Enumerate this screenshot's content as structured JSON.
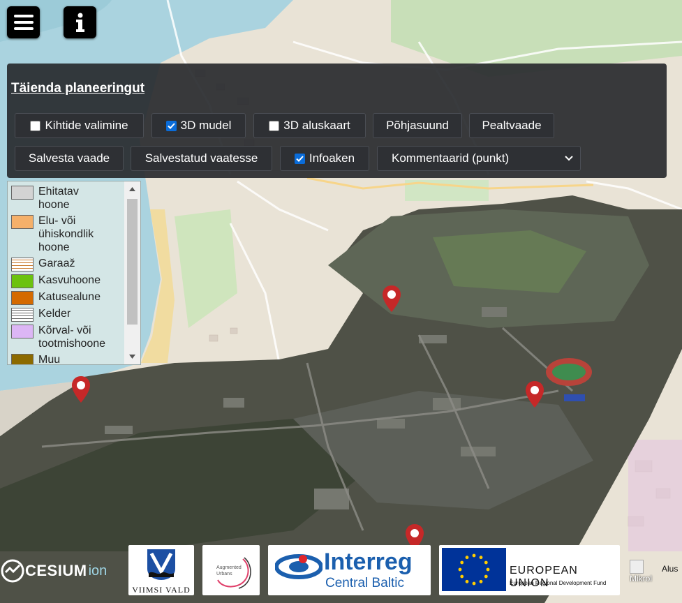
{
  "toolbar": {
    "title": "Täienda planeeringut",
    "buttons": {
      "layers": "Kihtide valimine",
      "model3d": "3D mudel",
      "basemap3d": "3D aluskaart",
      "north": "Põhjasuund",
      "topview": "Pealtvaade",
      "saveview": "Salvesta vaade",
      "savedviews": "Salvestatud vaatesse",
      "infowindow": "Infoaken"
    },
    "checkboxes": {
      "layers": false,
      "model3d": true,
      "basemap3d": false,
      "infowindow": true
    },
    "comments_select": "Kommentaarid (punkt)"
  },
  "legend": {
    "items": [
      {
        "line1": "Ehitatav",
        "line2": "hoone",
        "color": "#d3d3d3"
      },
      {
        "line1": "Elu- või",
        "line2": "ühiskondlik",
        "line3": "hoone",
        "color": "#f5b06a"
      },
      {
        "line1": "Garaaž",
        "pattern": "hatch-orange"
      },
      {
        "line1": "Kasvuhoone",
        "color": "#6cc20f"
      },
      {
        "line1": "Katusealune",
        "color": "#d46a00"
      },
      {
        "line1": "Kelder",
        "pattern": "hatch-gray"
      },
      {
        "line1": "Kõrval- või",
        "line2": "tootmishoone",
        "color": "#dcb6f5"
      },
      {
        "line1": "Muu",
        "color": "#8c6a00"
      }
    ]
  },
  "footer": {
    "cesium": "CESIUM",
    "cesium_ion": "ion",
    "viimsi": "VIIMSI VALD",
    "augmented": "Augmented",
    "urbans": "Urbans",
    "interreg": "Interreg",
    "central_baltic": "Central Baltic",
    "eu": "EUROPEAN UNION",
    "eu_fund": "European Regional Development Fund",
    "extra1": "Mikrol",
    "extra2": "Alus"
  },
  "colors": {
    "marker": "#c62828",
    "toolbar_bg": "#2e3034",
    "eu_blue": "#003399",
    "interreg_blue": "#1b5fae"
  }
}
